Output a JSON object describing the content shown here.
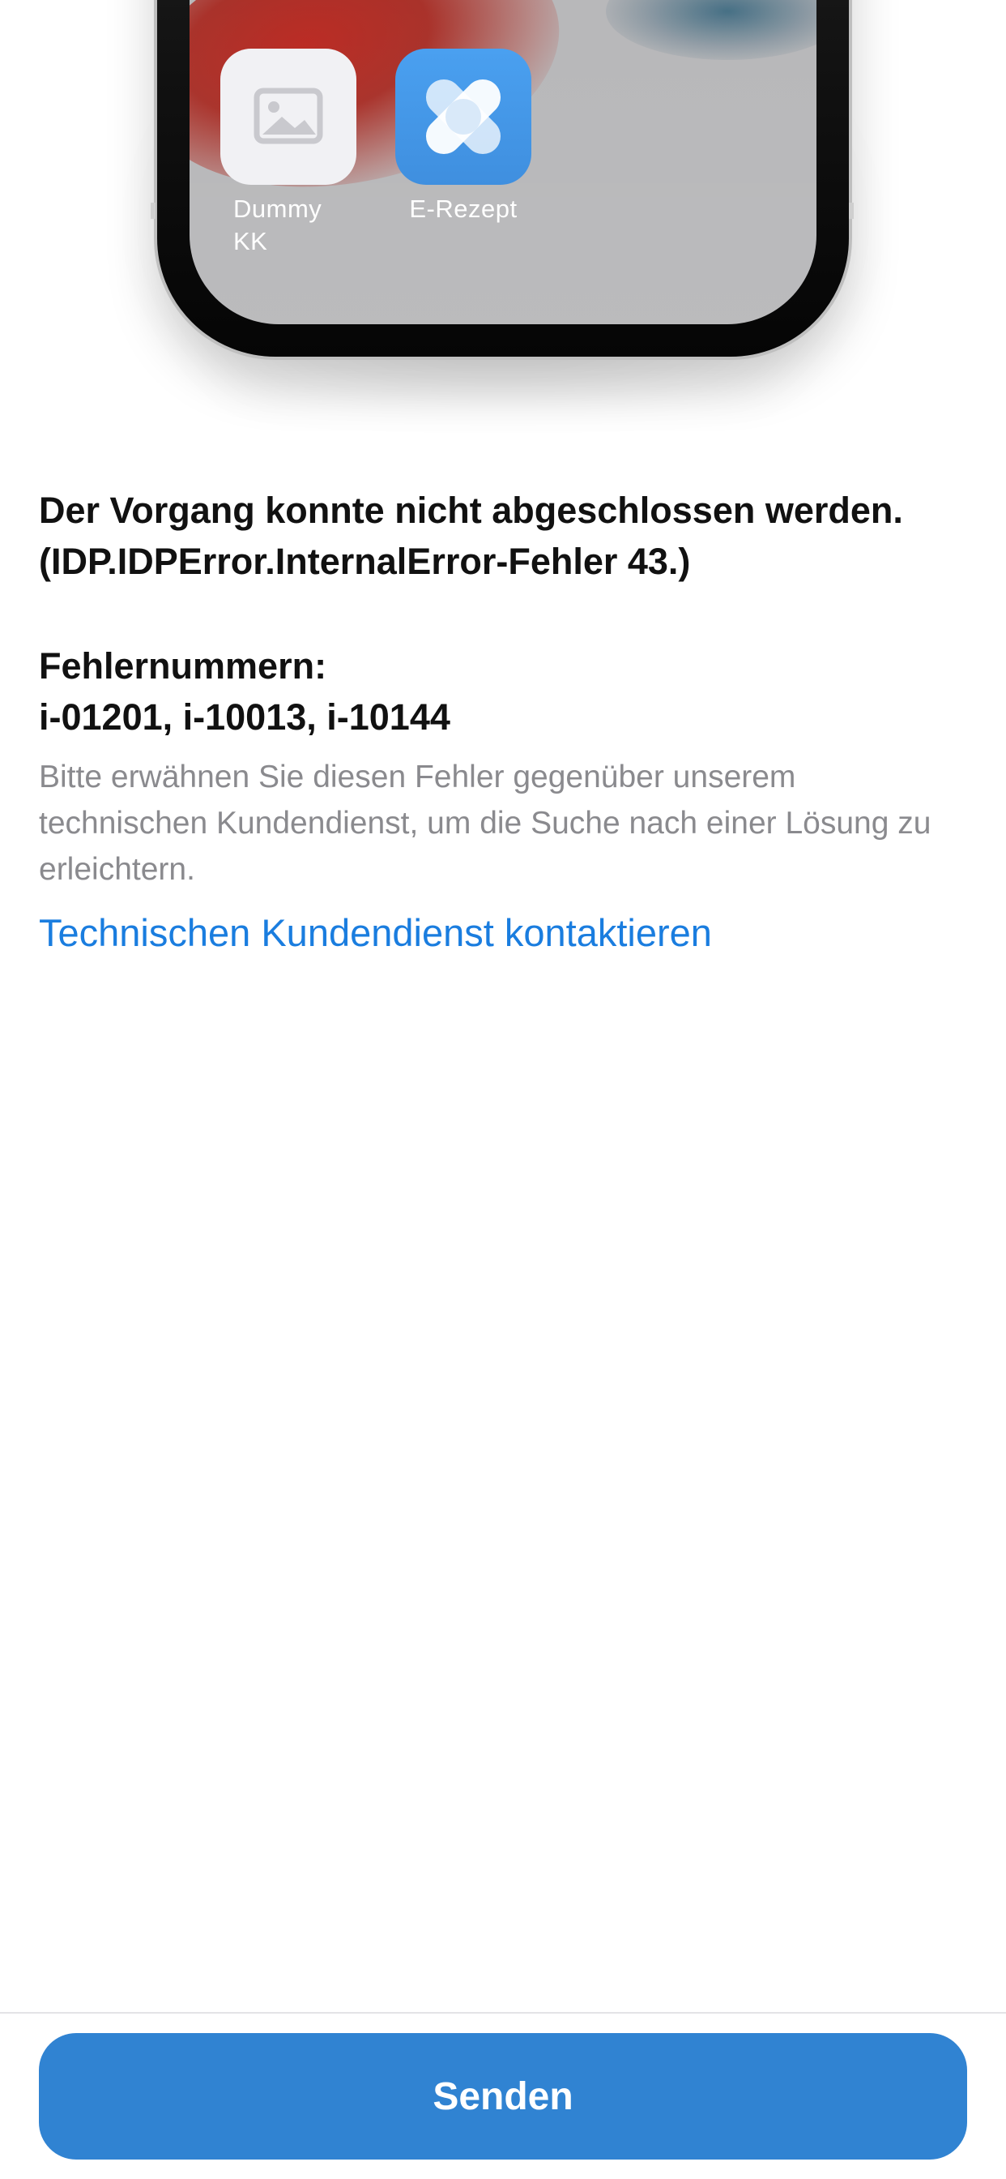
{
  "illustration": {
    "apps": [
      {
        "label": "Dummy\nKK",
        "icon": "image-placeholder-icon"
      },
      {
        "label": "E-Rezept",
        "icon": "erezept-heart-cross-icon"
      }
    ],
    "colors": {
      "dummy_icon_bg": "#f1f1f4",
      "erezept_icon_bg": "#3f8fdf"
    }
  },
  "error": {
    "message": "Der Vorgang konnte nicht abgeschlossen werden. (IDP.IDPError.InternalError-Fehler 43.)",
    "codes_heading": "Fehlernummern:",
    "codes": "i-01201, i-10013, i-10144",
    "hint": "Bitte erwähnen Sie diesen Fehler gegenüber unserem technischen Kundendienst, um die Suche nach einer Lösung zu erleichtern.",
    "support_link": "Technischen Kundendienst kontaktieren"
  },
  "footer": {
    "send_label": "Senden"
  },
  "colors": {
    "accent": "#1a7ddf",
    "button": "#3083d2"
  }
}
